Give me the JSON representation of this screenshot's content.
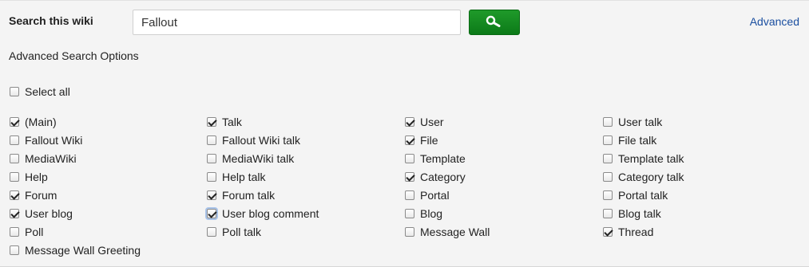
{
  "search": {
    "label": "Search this wiki",
    "value": "Fallout",
    "placeholder": "",
    "button_icon": "magnifier-icon",
    "advanced_link": "Advanced"
  },
  "options": {
    "title": "Advanced Search Options",
    "select_all": {
      "label": "Select all",
      "checked": false
    }
  },
  "namespaces": [
    [
      {
        "label": "(Main)",
        "checked": true
      },
      {
        "label": "Fallout Wiki",
        "checked": false
      },
      {
        "label": "MediaWiki",
        "checked": false
      },
      {
        "label": "Help",
        "checked": false
      },
      {
        "label": "Forum",
        "checked": true
      },
      {
        "label": "User blog",
        "checked": true
      },
      {
        "label": "Poll",
        "checked": false
      },
      {
        "label": "Message Wall Greeting",
        "checked": false
      }
    ],
    [
      {
        "label": "Talk",
        "checked": true
      },
      {
        "label": "Fallout Wiki talk",
        "checked": false
      },
      {
        "label": "MediaWiki talk",
        "checked": false
      },
      {
        "label": "Help talk",
        "checked": false
      },
      {
        "label": "Forum talk",
        "checked": true
      },
      {
        "label": "User blog comment",
        "checked": true,
        "focused": true
      },
      {
        "label": "Poll talk",
        "checked": false
      }
    ],
    [
      {
        "label": "User",
        "checked": true
      },
      {
        "label": "File",
        "checked": true
      },
      {
        "label": "Template",
        "checked": false
      },
      {
        "label": "Category",
        "checked": true
      },
      {
        "label": "Portal",
        "checked": false
      },
      {
        "label": "Blog",
        "checked": false
      },
      {
        "label": "Message Wall",
        "checked": false
      }
    ],
    [
      {
        "label": "User talk",
        "checked": false
      },
      {
        "label": "File talk",
        "checked": false
      },
      {
        "label": "Template talk",
        "checked": false
      },
      {
        "label": "Category talk",
        "checked": false
      },
      {
        "label": "Portal talk",
        "checked": false
      },
      {
        "label": "Blog talk",
        "checked": false
      },
      {
        "label": "Thread",
        "checked": true
      }
    ]
  ],
  "colors": {
    "button_green": "#148a22",
    "link_blue": "#1b4fa0"
  }
}
